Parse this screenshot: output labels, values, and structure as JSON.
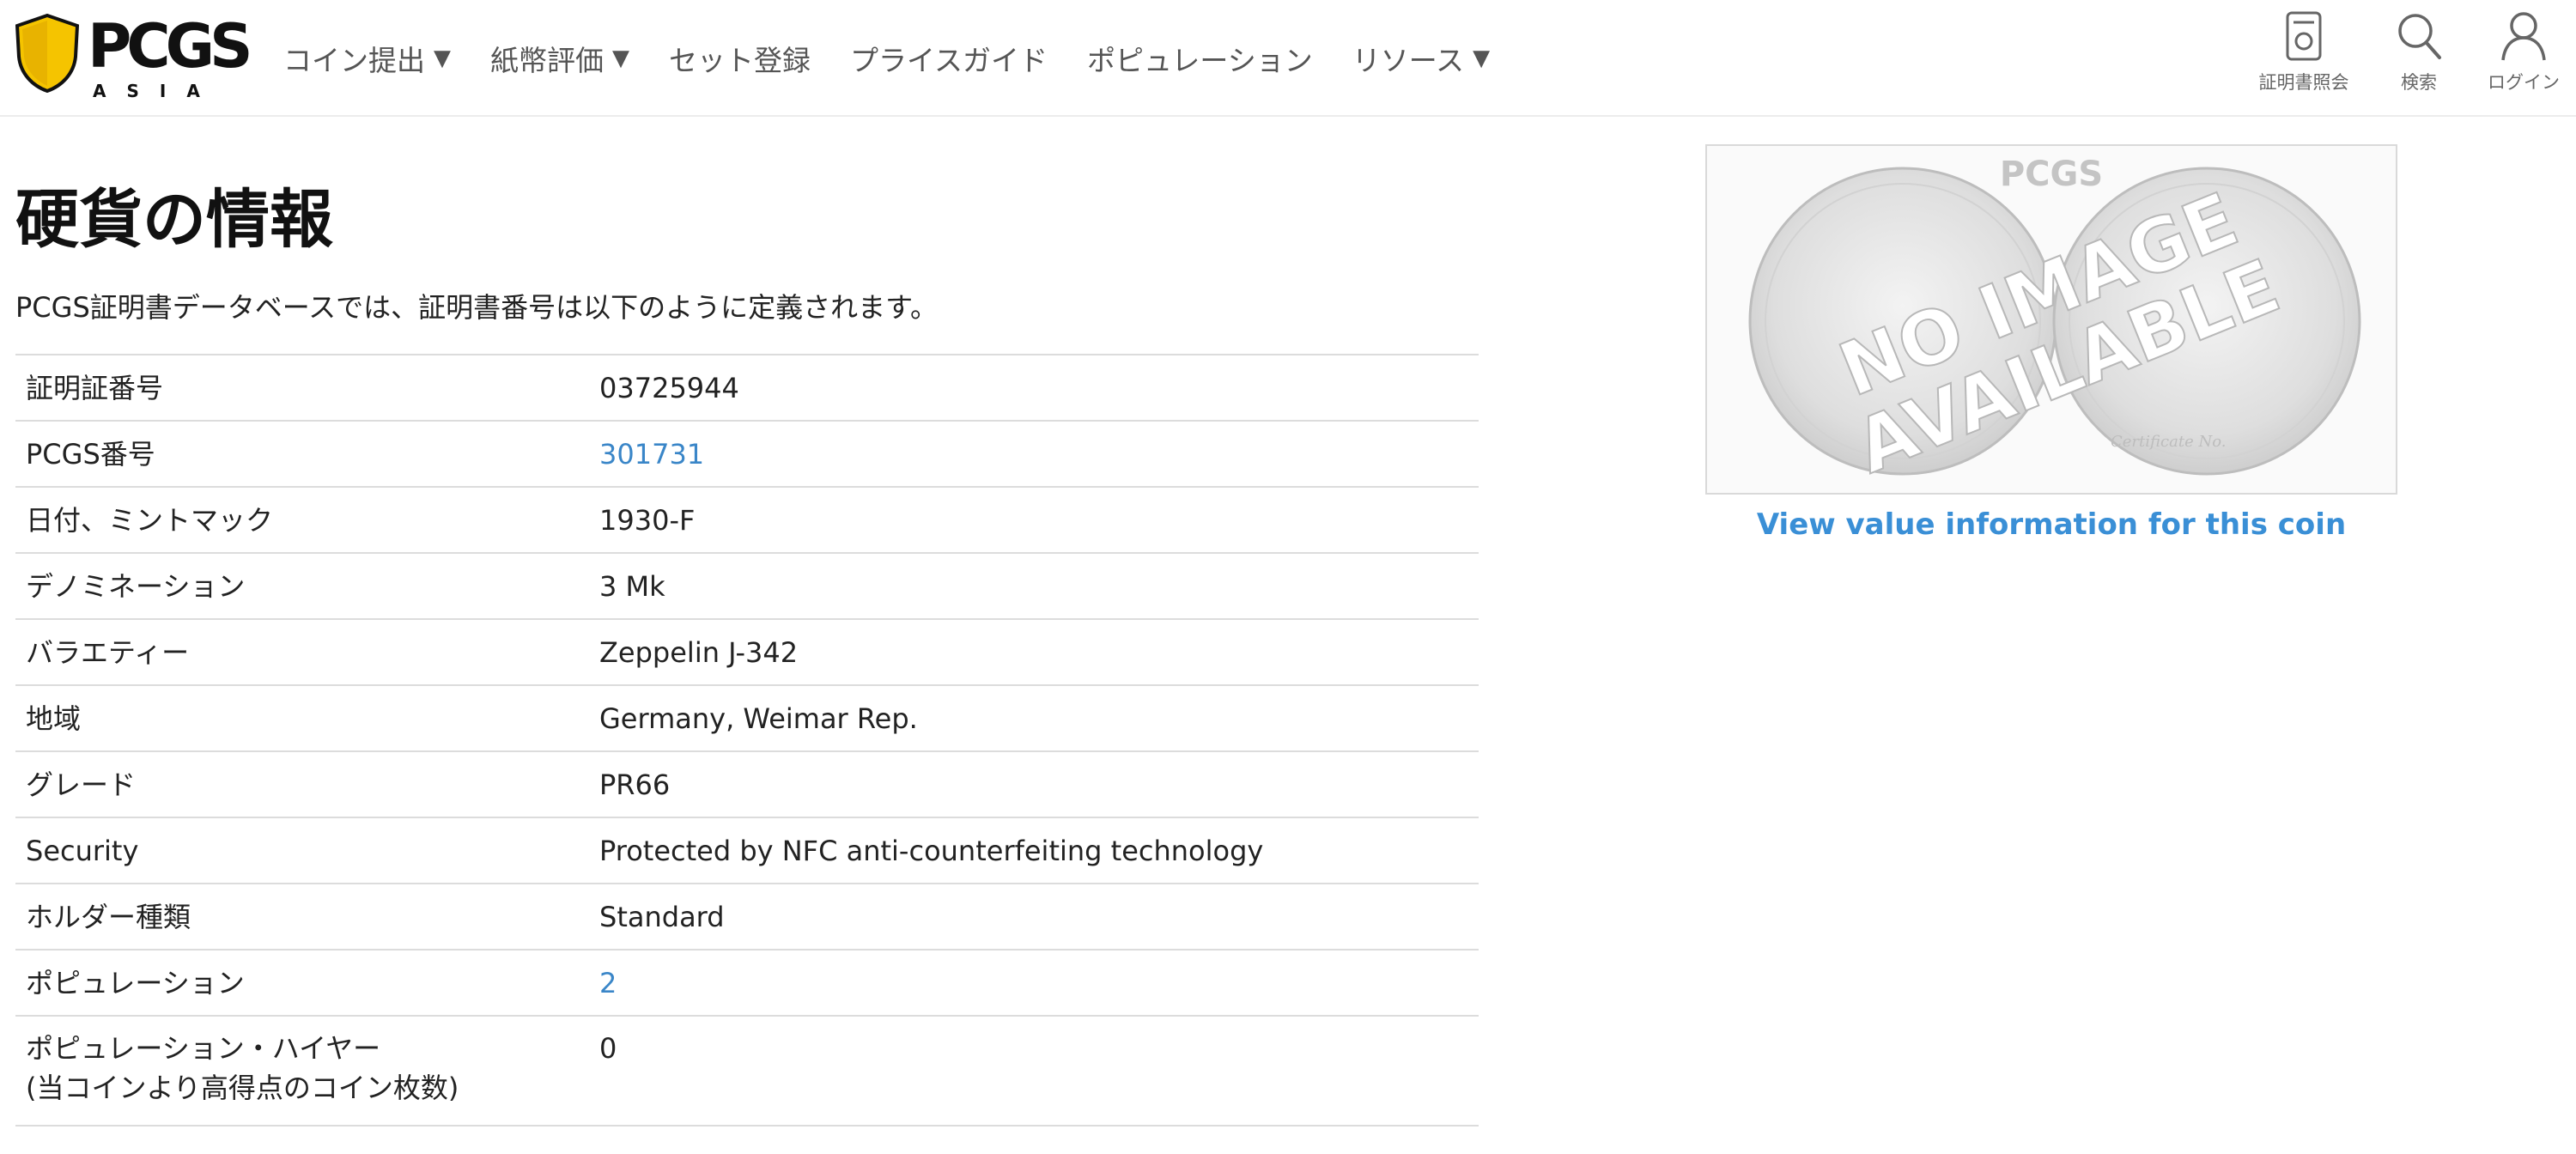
{
  "header": {
    "logo": {
      "wordmark": "PCGS",
      "sub": "ASIA",
      "colors": {
        "shield": "#f5c400",
        "text": "#111111"
      }
    },
    "nav": [
      {
        "label": "コイン提出",
        "has_dropdown": true
      },
      {
        "label": "紙幣評価",
        "has_dropdown": true
      },
      {
        "label": "セット登録",
        "has_dropdown": false
      },
      {
        "label": "プライスガイド",
        "has_dropdown": false
      },
      {
        "label": "ポピュレーション",
        "has_dropdown": false
      },
      {
        "label": "リソース",
        "has_dropdown": true
      }
    ],
    "dropdown_glyph": "▼",
    "utilities": [
      {
        "label": "証明書照会",
        "icon": "certificate-icon"
      },
      {
        "label": "検索",
        "icon": "search-icon"
      },
      {
        "label": "ログイン",
        "icon": "user-icon"
      }
    ]
  },
  "main": {
    "title": "硬貨の情報",
    "subtitle": "PCGS証明書データベースでは、証明書番号は以下のように定義されます。",
    "rows": [
      {
        "label": "証明証番号",
        "value": "03725944",
        "is_link": false
      },
      {
        "label": "PCGS番号",
        "value": "301731",
        "is_link": true
      },
      {
        "label": "日付、ミントマック",
        "value": "1930-F",
        "is_link": false
      },
      {
        "label": "デノミネーション",
        "value": "3 Mk",
        "is_link": false
      },
      {
        "label": "バラエティー",
        "value": "Zeppelin J-342",
        "is_link": false
      },
      {
        "label": "地域",
        "value": "Germany, Weimar Rep.",
        "is_link": false
      },
      {
        "label": "グレード",
        "value": "PR66",
        "is_link": false
      },
      {
        "label": "Security",
        "value": "Protected by NFC anti-counterfeiting technology",
        "is_link": false
      },
      {
        "label": "ホルダー種類",
        "value": "Standard",
        "is_link": false
      },
      {
        "label": "ポピュレーション",
        "value": "2",
        "is_link": true
      },
      {
        "label": "ポピュレーション・ハイヤー",
        "label2": "(当コインより高得点のコイン枚数)",
        "value": "0",
        "is_link": false
      }
    ]
  },
  "image_panel": {
    "placeholder_logo": "PCGS",
    "placeholder_text_line1": "NO IMAGE",
    "placeholder_text_line2": "AVAILABLE",
    "placeholder_caption": "Certificate No.",
    "value_link": "View value information for this coin"
  },
  "colors": {
    "link": "#3a86c8",
    "value_link": "#3a8fd6",
    "divider": "#dcdcdc",
    "nav_text": "#555555"
  }
}
